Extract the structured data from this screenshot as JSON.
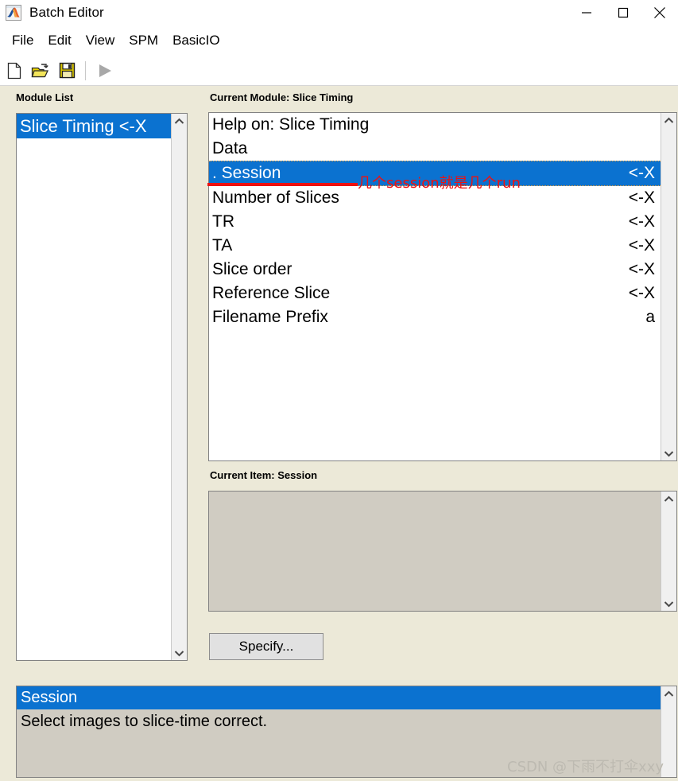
{
  "window": {
    "title": "Batch Editor",
    "icon": "matlab-icon",
    "controls": [
      {
        "name": "minimize",
        "glyph": "minimize-icon"
      },
      {
        "name": "maximize",
        "glyph": "maximize-icon"
      },
      {
        "name": "close",
        "glyph": "close-icon"
      }
    ]
  },
  "menubar": {
    "items": [
      {
        "label": "File"
      },
      {
        "label": "Edit"
      },
      {
        "label": "View"
      },
      {
        "label": "SPM"
      },
      {
        "label": "BasicIO"
      }
    ]
  },
  "toolbar": {
    "buttons": [
      {
        "name": "new-file",
        "icon": "new-file-icon"
      },
      {
        "name": "open-file",
        "icon": "open-folder-icon"
      },
      {
        "name": "save-file",
        "icon": "save-disk-icon"
      },
      {
        "name": "run-batch",
        "icon": "run-play-icon",
        "enabled": false
      }
    ]
  },
  "left_panel": {
    "label": "Module List",
    "modules": [
      {
        "label": "Slice Timing <-X",
        "selected": true
      }
    ]
  },
  "main_panel": {
    "label": "Current Module: Slice Timing",
    "items": [
      {
        "label": "Help on: Slice Timing",
        "value": "",
        "selected": false
      },
      {
        "label": "Data",
        "value": "",
        "selected": false
      },
      {
        "label": ". Session",
        "value": "<-X",
        "selected": true
      },
      {
        "label": "Number of Slices",
        "value": "<-X",
        "selected": false
      },
      {
        "label": "TR",
        "value": "<-X",
        "selected": false
      },
      {
        "label": "TA",
        "value": "<-X",
        "selected": false
      },
      {
        "label": "Slice order",
        "value": "<-X",
        "selected": false
      },
      {
        "label": "Reference Slice",
        "value": "<-X",
        "selected": false
      },
      {
        "label": "Filename Prefix",
        "value": "a",
        "selected": false
      }
    ]
  },
  "current_item": {
    "label": "Current Item: Session",
    "value": ""
  },
  "specify_button": {
    "label": "Specify..."
  },
  "help_panel": {
    "title": "Session",
    "body": "Select images to slice-time correct."
  },
  "annotation": {
    "text": "几个session就是几个run",
    "color": "#ee1111"
  },
  "watermark": {
    "text": "CSDN @下雨不打伞xxy"
  },
  "colors": {
    "selection_blue": "#0b72d0",
    "window_background": "#ece9d8",
    "field_background": "#d0ccc2",
    "list_background": "#ffffff",
    "annotation_red": "#ee1111"
  }
}
